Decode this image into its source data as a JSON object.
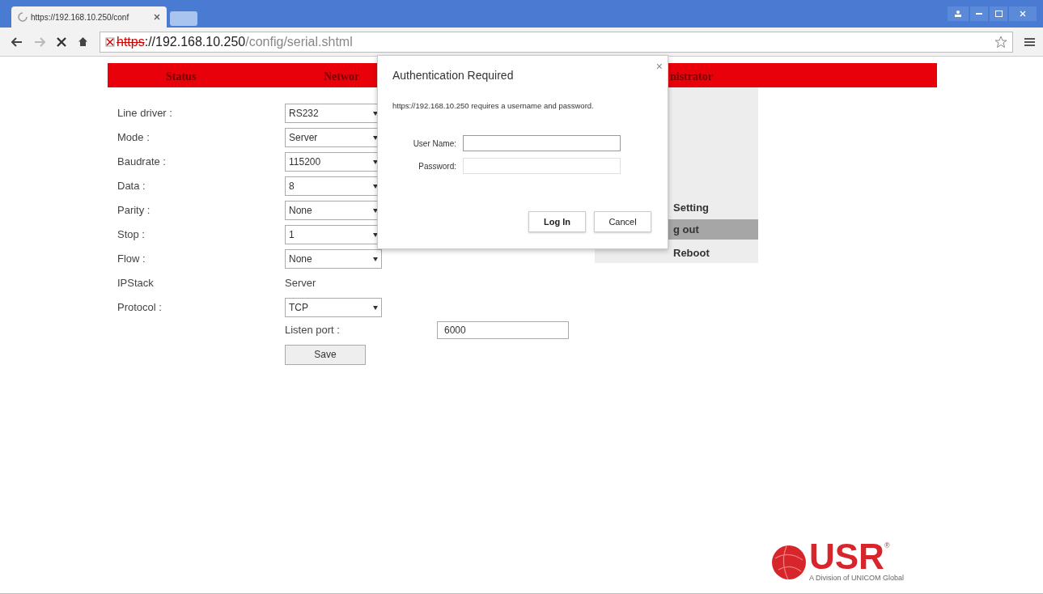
{
  "browser": {
    "tab_title": "https://192.168.10.250/conf",
    "url_scheme": "https",
    "url_host": "://192.168.10.250",
    "url_path": "/config/serial.shtml"
  },
  "nav": [
    {
      "label": "Status"
    },
    {
      "label": "Networ"
    },
    {
      "label": "nistrator"
    }
  ],
  "form": [
    {
      "kind": "select",
      "label": "Line driver :",
      "value": "RS232"
    },
    {
      "kind": "select",
      "label": "Mode :",
      "value": "Server"
    },
    {
      "kind": "select",
      "label": "Baudrate :",
      "value": "115200"
    },
    {
      "kind": "select",
      "label": "Data :",
      "value": "8"
    },
    {
      "kind": "select",
      "label": "Parity :",
      "value": "None"
    },
    {
      "kind": "select",
      "label": "Stop :",
      "value": "1"
    },
    {
      "kind": "select",
      "label": "Flow :",
      "value": "None"
    },
    {
      "kind": "text",
      "label": "IPStack",
      "value": "Server"
    },
    {
      "kind": "select",
      "label": "Protocol :",
      "value": "TCP"
    }
  ],
  "listen_port": {
    "label": "Listen port :",
    "value": "6000"
  },
  "save_button": "Save",
  "side_menu": [
    {
      "label": "Setting",
      "selected": false
    },
    {
      "label": "g out",
      "selected": true
    },
    {
      "label": "Reboot",
      "selected": false
    }
  ],
  "dialog": {
    "title": "Authentication Required",
    "close": "×",
    "message": "https://192.168.10.250 requires a username and password.",
    "fields": [
      {
        "label": "User Name:",
        "focused": true
      },
      {
        "label": "Password:",
        "focused": false
      }
    ],
    "buttons": [
      "Log In",
      "Cancel"
    ]
  },
  "logo": {
    "text": "USR",
    "mark": "®",
    "tagline": "A Division of UNICOM Global"
  }
}
